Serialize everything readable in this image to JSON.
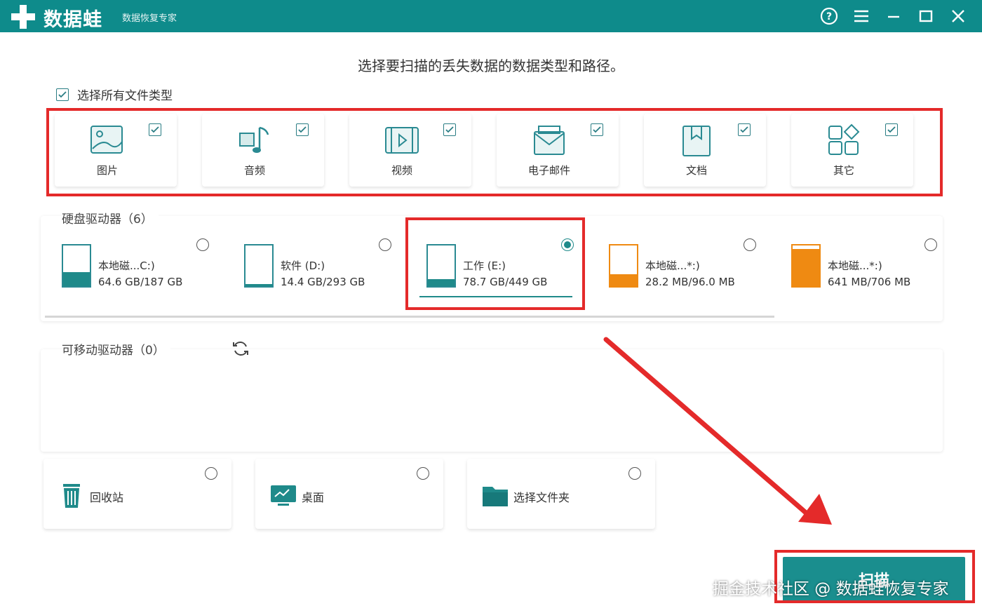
{
  "window": {
    "app_name": "数据蛙",
    "app_subtitle": "数据恢复专家",
    "controls": [
      "help-icon",
      "menu-icon",
      "minimize-icon",
      "maximize-icon",
      "close-icon"
    ],
    "accent_color": "#0e8b8b"
  },
  "main": {
    "heading": "选择要扫描的丢失数据的数据类型和路径。",
    "select_all_label": "选择所有文件类型",
    "file_types": [
      {
        "label": "图片",
        "icon": "image-icon",
        "checked": true
      },
      {
        "label": "音频",
        "icon": "audio-icon",
        "checked": true
      },
      {
        "label": "视频",
        "icon": "video-icon",
        "checked": true
      },
      {
        "label": "电子邮件",
        "icon": "email-icon",
        "checked": true
      },
      {
        "label": "文档",
        "icon": "document-icon",
        "checked": true
      },
      {
        "label": "其它",
        "icon": "other-icon",
        "checked": true
      }
    ],
    "drives_title": "硬盘驱动器（6）",
    "drives": [
      {
        "name": "本地磁...C:)",
        "size": "64.6 GB/187 GB",
        "usage": 0.35,
        "color": "#1f8a8a",
        "selected": false
      },
      {
        "name": "软件 (D:)",
        "size": "14.4 GB/293 GB",
        "usage": 0.05,
        "color": "#1f8a8a",
        "selected": false
      },
      {
        "name": "工作 (E:)",
        "size": "78.7 GB/449 GB",
        "usage": 0.18,
        "color": "#1f8a8a",
        "selected": true
      },
      {
        "name": "本地磁...*:)",
        "size": "28.2 MB/96.0 MB",
        "usage": 0.29,
        "color": "#ef8a12",
        "selected": false
      },
      {
        "name": "本地磁...*:)",
        "size": "641 MB/706 MB",
        "usage": 0.91,
        "color": "#ef8a12",
        "selected": false
      }
    ],
    "removable_title": "可移动驱动器（0）",
    "locations": [
      {
        "label": "回收站",
        "icon": "recycle-bin-icon"
      },
      {
        "label": "桌面",
        "icon": "desktop-icon"
      },
      {
        "label": "选择文件夹",
        "icon": "folder-icon"
      }
    ],
    "scan_label": "扫描"
  },
  "watermark": "掘金技术社区 @ 数据蛙恢复专家",
  "annotation_color": "#e42a2a"
}
